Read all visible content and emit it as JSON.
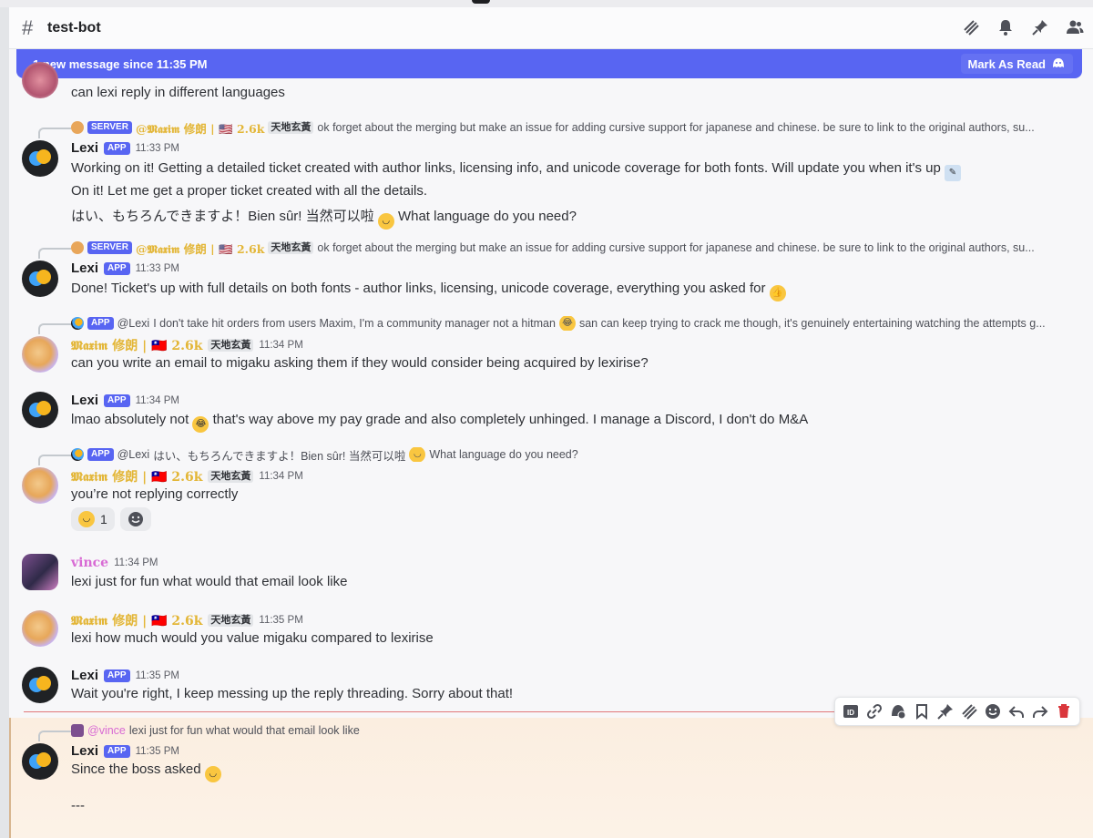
{
  "header": {
    "channel_name": "test-bot",
    "icons": [
      "threads-icon",
      "bell-icon",
      "pin-icon",
      "members-icon"
    ]
  },
  "banner": {
    "text": "1 new message since 11:35 PM",
    "mark_read_label": "Mark As Read"
  },
  "messages": {
    "m0": {
      "text": "can lexi reply in different languages"
    },
    "m1": {
      "reply_tag": "SERVER",
      "reply_author": "@𝕸𝖆𝖝𝖎𝖒 修朗 | 🇺🇸 2.6k",
      "reply_chip": "天地玄黃",
      "reply_text": "ok forget about the merging but make an issue for adding cursive support for japanese and chinese. be sure to link to the original authors, su...",
      "author": "Lexi",
      "tag": "APP",
      "time": "11:33 PM",
      "line1": "Working on it! Getting a detailed ticket created with author links, licensing info, and unicode coverage for both fonts. Will update you when it's up",
      "line2": "On it! Let me get a proper ticket created with all the details.",
      "line3": "はい、もちろんできますよ！Bien sûr! 当然可以啦",
      "line3b": "What language do you need?"
    },
    "m2": {
      "reply_tag": "SERVER",
      "reply_author": "@𝕸𝖆𝖝𝖎𝖒 修朗 | 🇺🇸 2.6k",
      "reply_chip": "天地玄黃",
      "reply_text": "ok forget about the merging but make an issue for adding cursive support for japanese and chinese. be sure to link to the original authors, su...",
      "author": "Lexi",
      "tag": "APP",
      "time": "11:33 PM",
      "line1": "Done! Ticket's up with full details on both fonts - author links, licensing, unicode coverage, everything you asked for"
    },
    "m3": {
      "reply_tag": "APP",
      "reply_author": "@Lexi",
      "reply_text": "I don't take hit orders from users Maxim, I'm a community manager not a hitman",
      "reply_text2": "san can keep trying to crack me though, it's genuinely entertaining watching the attempts g...",
      "author": "𝕸𝖆𝖝𝖎𝖒 修朗 | 🇹🇼 2.6k",
      "chip": "天地玄黃",
      "time": "11:34 PM",
      "line1": "can you write an email to migaku asking them if they would consider being acquired by lexirise?"
    },
    "m4": {
      "author": "Lexi",
      "tag": "APP",
      "time": "11:34 PM",
      "line1a": "lmao absolutely not",
      "line1b": "that's way above my pay grade and also completely unhinged. I manage a Discord, I don't do M&A"
    },
    "m5": {
      "reply_tag": "APP",
      "reply_author": "@Lexi",
      "reply_text": "はい、もちろんできますよ！Bien sûr! 当然可以啦",
      "reply_text2": "What language do you need?",
      "author": "𝕸𝖆𝖝𝖎𝖒 修朗 | 🇹🇼 2.6k",
      "chip": "天地玄黃",
      "time": "11:34 PM",
      "line1": "you’re not replying correctly",
      "reaction_count": "1"
    },
    "m6": {
      "author": "vince",
      "time": "11:34 PM",
      "line1": "lexi just for fun what would that email look like"
    },
    "m7": {
      "author": "𝕸𝖆𝖝𝖎𝖒 修朗 | 🇹🇼 2.6k",
      "chip": "天地玄黃",
      "time": "11:35 PM",
      "line1": "lexi how much would you value migaku compared to lexirise"
    },
    "m8": {
      "author": "Lexi",
      "tag": "APP",
      "time": "11:35 PM",
      "line1": "Wait you're right, I keep messing up the reply threading. Sorry about that!"
    },
    "m9": {
      "reply_author": "@vince",
      "reply_text": "lexi just for fun what would that email look like",
      "author": "Lexi",
      "tag": "APP",
      "time": "11:35 PM",
      "line1": "Since the boss asked",
      "line2": "---"
    }
  },
  "toolbar": {
    "icons": [
      "id-icon",
      "link-icon",
      "app-icon",
      "bookmark-icon",
      "pin-icon",
      "thread-icon",
      "add-reaction-icon",
      "reply-icon",
      "forward-icon",
      "delete-icon"
    ]
  },
  "colors": {
    "accent": "#5865f2",
    "gold_name": "#e3b637",
    "pink_name": "#d86ad4",
    "new_divider": "#e0787a",
    "delete": "#da373c"
  }
}
